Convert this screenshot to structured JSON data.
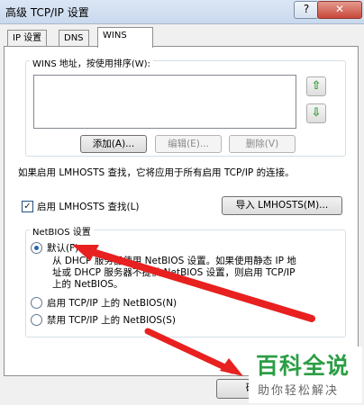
{
  "window": {
    "title": "高级 TCP/IP 设置",
    "help_glyph": "?",
    "close_glyph": "✕"
  },
  "tabs": [
    {
      "label": "IP 设置"
    },
    {
      "label": "DNS"
    },
    {
      "label": "WINS"
    }
  ],
  "wins": {
    "group_label": "WINS 地址，按使用排序(W):",
    "up_arrow": "⇧",
    "down_arrow": "⇩",
    "add_label": "添加(A)...",
    "edit_label": "编辑(E)...",
    "delete_label": "删除(V)"
  },
  "lmhosts": {
    "info_text": "如果启用 LMHOSTS 查找，它将应用于所有启用 TCP/IP 的连接。",
    "checkbox_label": "启用 LMHOSTS 查找(L)",
    "checkbox_checked": true,
    "check_glyph": "✓",
    "import_label": "导入 LMHOSTS(M)..."
  },
  "netbios": {
    "group_label": "NetBIOS 设置",
    "default_label": "默认(F):",
    "default_desc_line1": "从 DHCP 服务器使用 NetBIOS 设置。如果使用静态 IP 地",
    "default_desc_line2": "址或 DHCP 服务器不提供 NetBIOS 设置，则启用 TCP/IP",
    "default_desc_line3": "上的 NetBIOS。",
    "enable_label": "启用 TCP/IP 上的 NetBIOS(N)",
    "disable_label": "禁用 TCP/IP 上的 NetBIOS(S)"
  },
  "footer": {
    "ok_label": "确"
  },
  "watermark": {
    "title": "百科全说",
    "subtitle": "助你轻松解决"
  },
  "colors": {
    "annotation_arrow": "#e82020",
    "watermark_green": "#2b9e44"
  }
}
